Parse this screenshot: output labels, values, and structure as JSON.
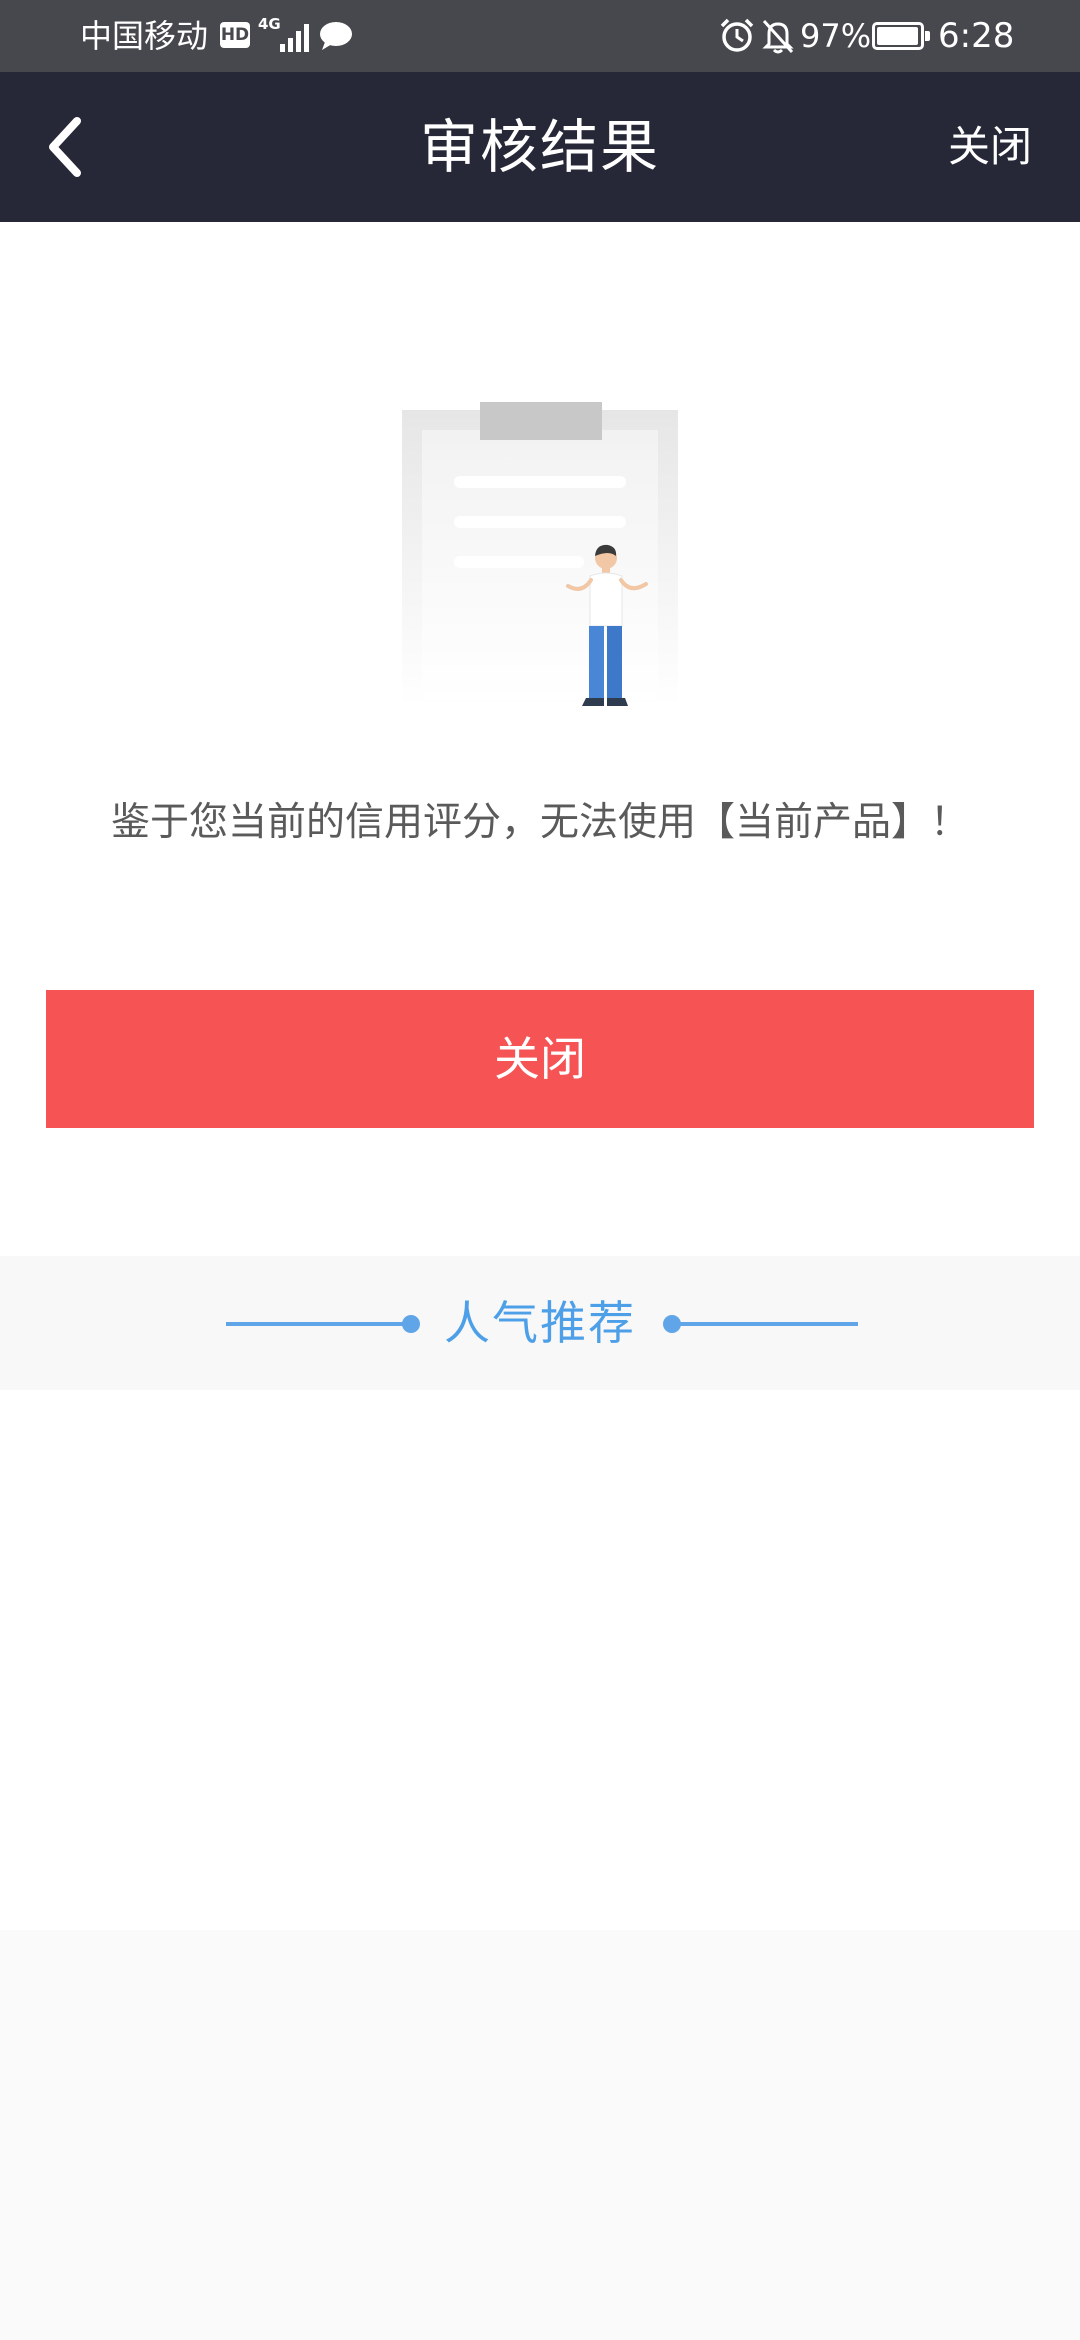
{
  "status_bar": {
    "carrier": "中国移动",
    "hd_badge": "HD",
    "network": "4G",
    "battery_percent": "97%",
    "battery_level": 0.97,
    "time": "6:28",
    "icons": [
      "hd-icon",
      "signal-icon",
      "message-icon",
      "alarm-icon",
      "mute-bell-icon",
      "battery-icon"
    ]
  },
  "header": {
    "title": "审核结果",
    "close_label": "关闭",
    "back_icon": "chevron-left-icon",
    "background": "#262838"
  },
  "main": {
    "illustration": "clipboard-person-shrug-illustration",
    "message": "鉴于您当前的信用评分，无法使用【当前产品】！",
    "close_button_label": "关闭",
    "button_color": "#f65354"
  },
  "recommend": {
    "title": "人气推荐",
    "accent_color": "#4d9fe8"
  }
}
